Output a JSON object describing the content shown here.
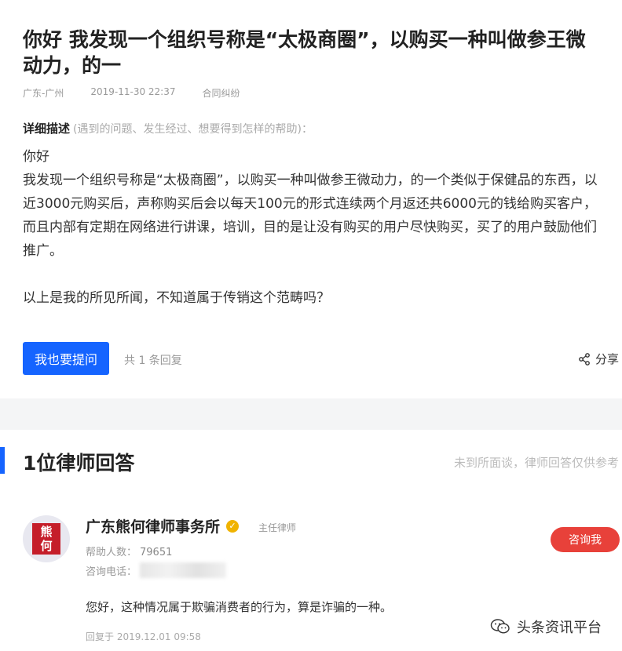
{
  "question": {
    "title": "你好 我发现一个组织号称是“太极商圈”，以购买一种叫做参王微动力，的一",
    "location": "广东-广州",
    "date": "2019-11-30 22:37",
    "category": "合同纠纷",
    "desc_label": "详细描述",
    "desc_hint": "(遇到的问题、发生经过、想要得到怎样的帮助)：",
    "body_greeting": "你好",
    "body_main": "我发现一个组织号称是“太极商圈”，以购买一种叫做参王微动力，的一个类似于保健品的东西，以近3000元购买后，声称购买后会以每天100元的形式连续两个月返还共6000元的钱给购买客户，而且内部有定期在网络进行讲课，培训，目的是让没有购买的用户尽快购买，买了的用户鼓励他们推广。",
    "body_end": "以上是我的所见所闻，不知道属于传销这个范畴吗？",
    "ask_button": "我也要提问",
    "reply_count": "共 1 条回复",
    "share_label": "分享"
  },
  "answers": {
    "title": "1位律师回答",
    "note": "未到所面谈，律师回答仅供参考",
    "lawyer": {
      "avatar_text_1": "熊",
      "avatar_text_2": "何",
      "firm": "广东熊何律师事务所",
      "role": "主任律师",
      "help_label": "帮助人数：",
      "help_count": "79651",
      "phone_label": "咨询电话：",
      "consult_button": "咨询我"
    },
    "answer_text": "您好，这种情况属于欺骗消费者的行为，算是诈骗的一种。",
    "answer_time": "回复于 2019.12.01 09:58"
  },
  "watermark": "头条资讯平台",
  "colors": {
    "accent_blue": "#1564ff",
    "consult_red": "#e8413a",
    "verified_gold": "#f0b300"
  }
}
